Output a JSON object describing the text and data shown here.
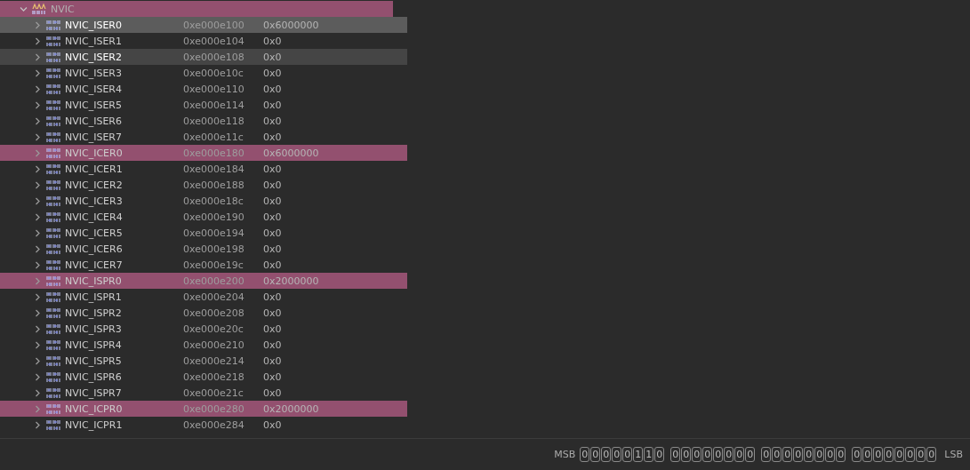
{
  "peripheral": {
    "name": "NVIC",
    "expanded": true,
    "changed": true
  },
  "registers": [
    {
      "name": "NVIC_ISER0",
      "address": "0xe000e100",
      "value": "0x6000000",
      "selected": true,
      "hovered": false,
      "changed": false
    },
    {
      "name": "NVIC_ISER1",
      "address": "0xe000e104",
      "value": "0x0",
      "selected": false,
      "hovered": false,
      "changed": false
    },
    {
      "name": "NVIC_ISER2",
      "address": "0xe000e108",
      "value": "0x0",
      "selected": false,
      "hovered": true,
      "changed": false
    },
    {
      "name": "NVIC_ISER3",
      "address": "0xe000e10c",
      "value": "0x0",
      "selected": false,
      "hovered": false,
      "changed": false
    },
    {
      "name": "NVIC_ISER4",
      "address": "0xe000e110",
      "value": "0x0",
      "selected": false,
      "hovered": false,
      "changed": false
    },
    {
      "name": "NVIC_ISER5",
      "address": "0xe000e114",
      "value": "0x0",
      "selected": false,
      "hovered": false,
      "changed": false
    },
    {
      "name": "NVIC_ISER6",
      "address": "0xe000e118",
      "value": "0x0",
      "selected": false,
      "hovered": false,
      "changed": false
    },
    {
      "name": "NVIC_ISER7",
      "address": "0xe000e11c",
      "value": "0x0",
      "selected": false,
      "hovered": false,
      "changed": false
    },
    {
      "name": "NVIC_ICER0",
      "address": "0xe000e180",
      "value": "0x6000000",
      "selected": false,
      "hovered": false,
      "changed": true
    },
    {
      "name": "NVIC_ICER1",
      "address": "0xe000e184",
      "value": "0x0",
      "selected": false,
      "hovered": false,
      "changed": false
    },
    {
      "name": "NVIC_ICER2",
      "address": "0xe000e188",
      "value": "0x0",
      "selected": false,
      "hovered": false,
      "changed": false
    },
    {
      "name": "NVIC_ICER3",
      "address": "0xe000e18c",
      "value": "0x0",
      "selected": false,
      "hovered": false,
      "changed": false
    },
    {
      "name": "NVIC_ICER4",
      "address": "0xe000e190",
      "value": "0x0",
      "selected": false,
      "hovered": false,
      "changed": false
    },
    {
      "name": "NVIC_ICER5",
      "address": "0xe000e194",
      "value": "0x0",
      "selected": false,
      "hovered": false,
      "changed": false
    },
    {
      "name": "NVIC_ICER6",
      "address": "0xe000e198",
      "value": "0x0",
      "selected": false,
      "hovered": false,
      "changed": false
    },
    {
      "name": "NVIC_ICER7",
      "address": "0xe000e19c",
      "value": "0x0",
      "selected": false,
      "hovered": false,
      "changed": false
    },
    {
      "name": "NVIC_ISPR0",
      "address": "0xe000e200",
      "value": "0x2000000",
      "selected": false,
      "hovered": false,
      "changed": true
    },
    {
      "name": "NVIC_ISPR1",
      "address": "0xe000e204",
      "value": "0x0",
      "selected": false,
      "hovered": false,
      "changed": false
    },
    {
      "name": "NVIC_ISPR2",
      "address": "0xe000e208",
      "value": "0x0",
      "selected": false,
      "hovered": false,
      "changed": false
    },
    {
      "name": "NVIC_ISPR3",
      "address": "0xe000e20c",
      "value": "0x0",
      "selected": false,
      "hovered": false,
      "changed": false
    },
    {
      "name": "NVIC_ISPR4",
      "address": "0xe000e210",
      "value": "0x0",
      "selected": false,
      "hovered": false,
      "changed": false
    },
    {
      "name": "NVIC_ISPR5",
      "address": "0xe000e214",
      "value": "0x0",
      "selected": false,
      "hovered": false,
      "changed": false
    },
    {
      "name": "NVIC_ISPR6",
      "address": "0xe000e218",
      "value": "0x0",
      "selected": false,
      "hovered": false,
      "changed": false
    },
    {
      "name": "NVIC_ISPR7",
      "address": "0xe000e21c",
      "value": "0x0",
      "selected": false,
      "hovered": false,
      "changed": false
    },
    {
      "name": "NVIC_ICPR0",
      "address": "0xe000e280",
      "value": "0x2000000",
      "selected": false,
      "hovered": false,
      "changed": true
    },
    {
      "name": "NVIC_ICPR1",
      "address": "0xe000e284",
      "value": "0x0",
      "selected": false,
      "hovered": false,
      "changed": false
    }
  ],
  "bit_view": {
    "msb_label": "MSB",
    "lsb_label": "LSB",
    "bytes": [
      [
        "0",
        "0",
        "0",
        "0",
        "0",
        "1",
        "1",
        "0"
      ],
      [
        "0",
        "0",
        "0",
        "0",
        "0",
        "0",
        "0",
        "0"
      ],
      [
        "0",
        "0",
        "0",
        "0",
        "0",
        "0",
        "0",
        "0"
      ],
      [
        "0",
        "0",
        "0",
        "0",
        "0",
        "0",
        "0",
        "0"
      ]
    ]
  }
}
